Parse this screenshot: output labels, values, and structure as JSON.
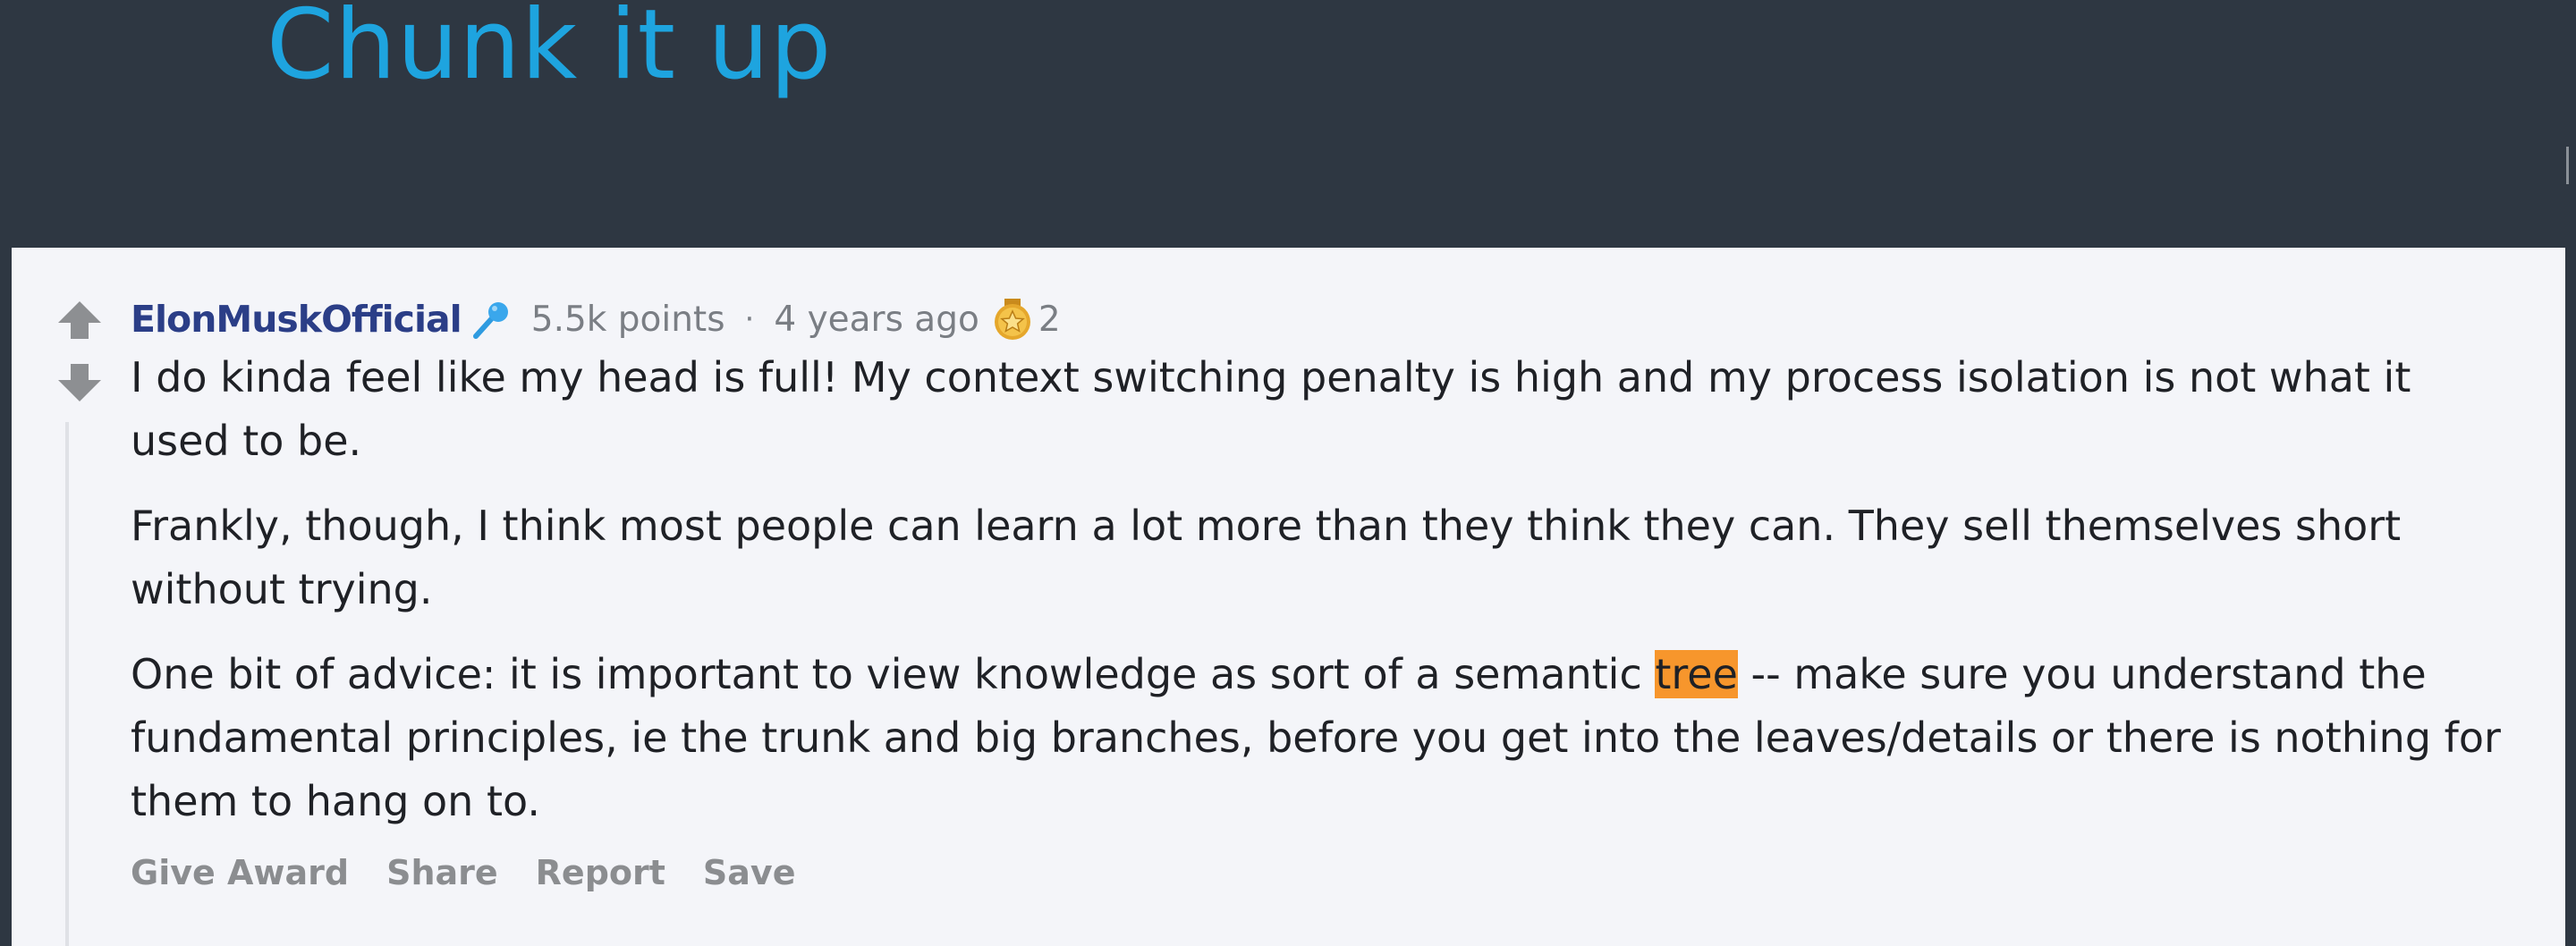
{
  "slide": {
    "title": "Chunk it up"
  },
  "comment": {
    "author": "ElonMuskOfficial",
    "points": "5.5k points",
    "separator": "·",
    "age": "4 years ago",
    "award_count": "2",
    "paragraphs": {
      "p1": "I do kinda feel like my head is full! My context switching penalty is high and my process isolation is not what it used to be.",
      "p2": "Frankly, though, I think most people can learn a lot more than they think they can. They sell themselves short without trying.",
      "p3_before": "One bit of advice: it is important to view knowledge as sort of a semantic ",
      "p3_highlight": "tree",
      "p3_after": " -- make sure you understand the fundamental principles, ie the trunk and big branches, before you get into the leaves/details or there is nothing for them to hang on to."
    },
    "actions": {
      "give_award": "Give Award",
      "share": "Share",
      "report": "Report",
      "save": "Save"
    }
  },
  "icons": {
    "upvote": "arrow-up-icon",
    "downvote": "arrow-down-icon",
    "flair": "microphone-icon",
    "award": "award-medal-icon"
  },
  "colors": {
    "background": "#2e3742",
    "title": "#1ea4df",
    "card": "#f4f5f9",
    "author": "#2b3e87",
    "highlight": "#f7962c",
    "muted": "#7a7e84"
  }
}
